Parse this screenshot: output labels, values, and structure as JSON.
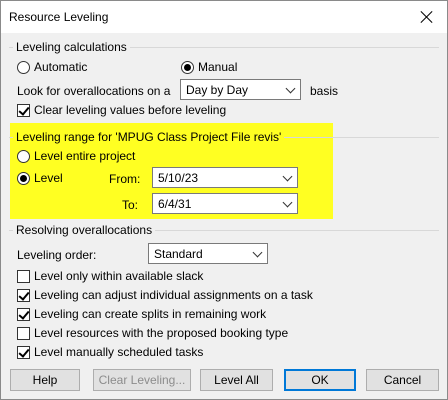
{
  "window": {
    "title": "Resource Leveling"
  },
  "calculations": {
    "legend": "Leveling calculations",
    "automatic_label": "Automatic",
    "manual_label": "Manual",
    "mode": "Manual",
    "look_for_label": "Look for overallocations on a",
    "basis_value": "Day by Day",
    "basis_suffix": "basis",
    "clear_values_label": "Clear leveling values before leveling",
    "clear_values_checked": true
  },
  "range": {
    "legend": "Leveling range for 'MPUG Class Project File revis'",
    "entire_label": "Level entire project",
    "level_label": "Level",
    "selected": "Level",
    "from_label": "From:",
    "from_value": "5/10/23",
    "to_label": "To:",
    "to_value": "6/4/31",
    "highlight_color": "#ffff22"
  },
  "resolving": {
    "legend": "Resolving overallocations",
    "order_label": "Leveling order:",
    "order_value": "Standard",
    "options": [
      {
        "label": "Level only within available slack",
        "checked": false
      },
      {
        "label": "Leveling can adjust individual assignments on a task",
        "checked": true
      },
      {
        "label": "Leveling can create splits in remaining work",
        "checked": true
      },
      {
        "label": "Level resources with the proposed booking type",
        "checked": false
      },
      {
        "label": "Level manually scheduled tasks",
        "checked": true
      }
    ]
  },
  "buttons": {
    "help": "Help",
    "clear": "Clear Leveling...",
    "level_all": "Level All",
    "ok": "OK",
    "cancel": "Cancel"
  }
}
